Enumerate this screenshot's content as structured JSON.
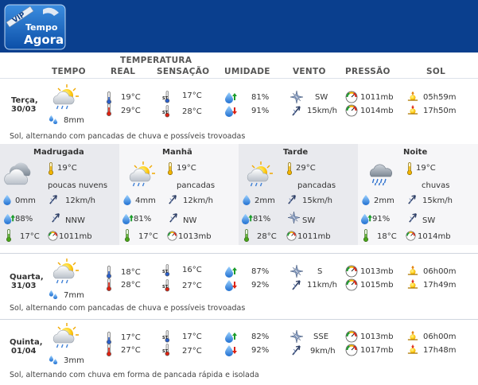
{
  "header": {
    "logo_line1": "Tempo",
    "logo_line2": "Agora",
    "logo_badge": "VIP",
    "bg": "#0a3f8e"
  },
  "columns": {
    "group": "TEMPERATURA",
    "tempo": "TEMPO",
    "real": "REAL",
    "sensacao": "SENSAÇÃO",
    "umidade": "UMIDADE",
    "vento": "VENTO",
    "pressao": "PRESSÃO",
    "sol": "SOL"
  },
  "days": [
    {
      "day": "Terça,",
      "date": "30/03",
      "rain": "8mm",
      "tmin": "19°C",
      "tmax": "29°C",
      "smin": "17°C",
      "smax": "28°C",
      "hmin": "81%",
      "hmax": "91%",
      "wdir": "SW",
      "wspd": "15km/h",
      "pmin": "1011mb",
      "pmax": "1014mb",
      "sunrise": "05h59m",
      "sunset": "17h50m",
      "desc": "Sol, alternando com pancadas de chuva e possíveis trovoadas"
    },
    {
      "day": "Quarta,",
      "date": "31/03",
      "rain": "7mm",
      "tmin": "18°C",
      "tmax": "28°C",
      "smin": "16°C",
      "smax": "27°C",
      "hmin": "87%",
      "hmax": "92%",
      "wdir": "S",
      "wspd": "11km/h",
      "pmin": "1013mb",
      "pmax": "1015mb",
      "sunrise": "06h00m",
      "sunset": "17h49m",
      "desc": "Sol, alternando com pancadas de chuva e possíveis trovoadas"
    },
    {
      "day": "Quinta,",
      "date": "01/04",
      "rain": "3mm",
      "tmin": "17°C",
      "tmax": "27°C",
      "smin": "17°C",
      "smax": "27°C",
      "hmin": "82%",
      "hmax": "92%",
      "wdir": "SSE",
      "wspd": "9km/h",
      "pmin": "1013mb",
      "pmax": "1017mb",
      "sunrise": "06h00m",
      "sunset": "17h48m",
      "desc": "Sol, alternando com chuva em forma de pancada rápida e isolada"
    }
  ],
  "periods": [
    {
      "name": "Madrugada",
      "temp": "19°C",
      "cond": "poucas nuvens",
      "rain": "0mm",
      "wind": "12km/h",
      "hum": "88%",
      "wdir": "NNW",
      "feel": "17°C",
      "press": "1011mb",
      "icon": "cloudy-icon"
    },
    {
      "name": "Manhã",
      "temp": "19°C",
      "cond": "pancadas",
      "rain": "4mm",
      "wind": "12km/h",
      "hum": "81%",
      "wdir": "NW",
      "feel": "17°C",
      "press": "1013mb",
      "icon": "sun-rain-icon"
    },
    {
      "name": "Tarde",
      "temp": "29°C",
      "cond": "pancadas",
      "rain": "2mm",
      "wind": "15km/h",
      "hum": "81%",
      "wdir": "SW",
      "feel": "28°C",
      "press": "1011mb",
      "icon": "sun-rain-icon"
    },
    {
      "name": "Noite",
      "temp": "19°C",
      "cond": "chuvas",
      "rain": "2mm",
      "wind": "15km/h",
      "hum": "91%",
      "wdir": "SW",
      "feel": "18°C",
      "press": "1014mb",
      "icon": "rain-cloud-icon"
    }
  ]
}
